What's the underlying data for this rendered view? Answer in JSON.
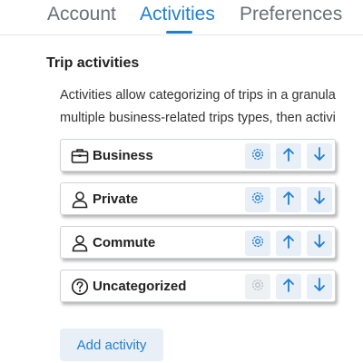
{
  "tabs": [
    {
      "label": "Account",
      "active": false
    },
    {
      "label": "Activities",
      "active": true
    },
    {
      "label": "Preferences",
      "active": false
    }
  ],
  "section": {
    "title": "Trip activities",
    "description_line1": "Activities allow categorizing of trips in a granula",
    "description_line2": "multiple business-related trips types, then activi"
  },
  "activities": [
    {
      "label": "Business",
      "icon": "briefcase-icon",
      "settings_enabled": true
    },
    {
      "label": "Private",
      "icon": "person-icon",
      "settings_enabled": true
    },
    {
      "label": "Commute",
      "icon": "person-icon",
      "settings_enabled": true
    },
    {
      "label": "Uncategorized",
      "icon": "question-circle-icon",
      "settings_enabled": false
    }
  ],
  "add_button": {
    "label": "Add activity"
  },
  "colors": {
    "accent": "#1f7fd4",
    "button_bg": "#e8eff7",
    "muted_tab": "#6b7076"
  }
}
